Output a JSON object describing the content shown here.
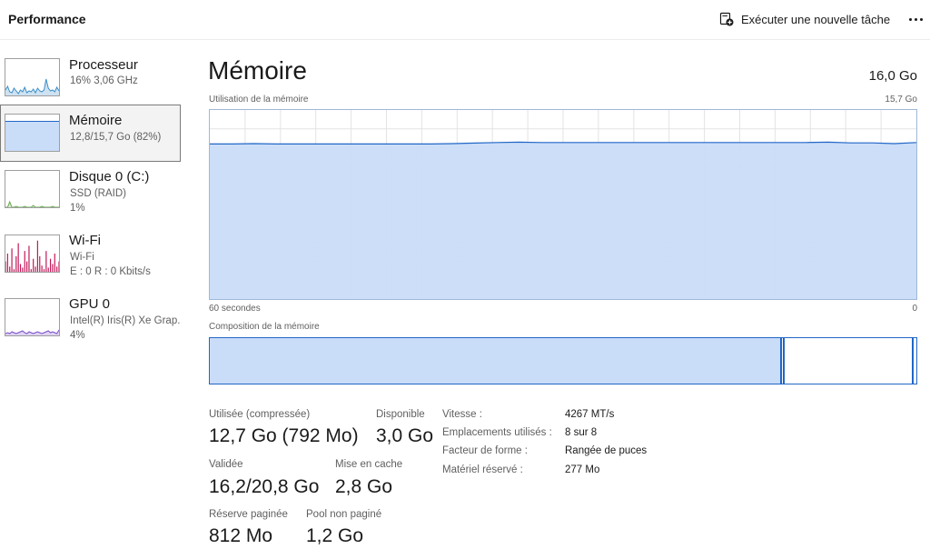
{
  "header": {
    "title": "Performance",
    "run_task_label": "Exécuter une nouvelle tâche",
    "run_task_icon": "new-task-icon",
    "more_icon": "more-horizontal-icon"
  },
  "sidebar": {
    "items": [
      {
        "name": "Processeur",
        "sub1": "16%  3,06 GHz",
        "sub2": "",
        "color": "#3a8dc9",
        "series": [
          6,
          10,
          4,
          3,
          8,
          5,
          2,
          6,
          4,
          9,
          3,
          5,
          4,
          7,
          3,
          8,
          5,
          4,
          6,
          18,
          8,
          5,
          6,
          4,
          9,
          5
        ]
      },
      {
        "name": "Mémoire",
        "sub1": "12,8/15,7 Go (82%)",
        "sub2": "",
        "color": "#2167c7",
        "selected": true
      },
      {
        "name": "Disque 0 (C:)",
        "sub1": "SSD (RAID)",
        "sub2": "1%",
        "color": "#6aa84f",
        "series": [
          0,
          0,
          6,
          0,
          0,
          1,
          0,
          0,
          0,
          1,
          0,
          0,
          0,
          2,
          0,
          0,
          0,
          1,
          0,
          0,
          0,
          0,
          1,
          0,
          0,
          0
        ]
      },
      {
        "name": "Wi-Fi",
        "sub1": "Wi-Fi",
        "sub2": "E : 0 R : 0 Kbits/s",
        "color": "#c2185b",
        "series": [
          20,
          35,
          10,
          45,
          5,
          30,
          55,
          15,
          8,
          40,
          20,
          50,
          5,
          25,
          10,
          60,
          30,
          12,
          5,
          40,
          8,
          25,
          15,
          35,
          10,
          20
        ]
      },
      {
        "name": "GPU 0",
        "sub1": "Intel(R) Iris(R) Xe Grap...",
        "sub2": "4%",
        "color": "#7b4fc9",
        "series": [
          2,
          3,
          2,
          4,
          3,
          2,
          3,
          4,
          5,
          3,
          2,
          4,
          3,
          2,
          3,
          4,
          3,
          2,
          3,
          4,
          5,
          3,
          4,
          3,
          2,
          6
        ]
      }
    ]
  },
  "main": {
    "title": "Mémoire",
    "total": "16,0 Go",
    "graph_label": "Utilisation de la mémoire",
    "graph_max": "15,7 Go",
    "time_left": "60 secondes",
    "time_right": "0",
    "composition_label": "Composition de la mémoire",
    "composition": {
      "in_use_fraction": 0.81,
      "modified_fraction": 0.005,
      "standby_fraction": 0.18
    },
    "graph_series": [
      82,
      82,
      82.2,
      82,
      82,
      82,
      82,
      82,
      82,
      82,
      82,
      82.2,
      82.5,
      82.8,
      83,
      82.8,
      82.8,
      82.8,
      82.8,
      82.8,
      82.8,
      82.8,
      82.8,
      82.8,
      82.8,
      82.8,
      82.8,
      82.8,
      83,
      82.6,
      82.6,
      82.2,
      82.8
    ],
    "graph_fill": "#c9dcf8",
    "graph_line": "#2167c7",
    "stats": {
      "used_label": "Utilisée (compressée)",
      "used_value": "12,7 Go (792 Mo)",
      "available_label": "Disponible",
      "available_value": "3,0 Go",
      "committed_label": "Validée",
      "committed_value": "16,2/20,8 Go",
      "cached_label": "Mise en cache",
      "cached_value": "2,8 Go",
      "paged_label": "Réserve paginée",
      "paged_value": "812 Mo",
      "nonpaged_label": "Pool non paginé",
      "nonpaged_value": "1,2 Go"
    },
    "properties": [
      {
        "label": "Vitesse :",
        "value": "4267 MT/s"
      },
      {
        "label": "Emplacements utilisés :",
        "value": "8 sur 8"
      },
      {
        "label": "Facteur de forme :",
        "value": "Rangée de puces"
      },
      {
        "label": "Matériel réservé :",
        "value": "277 Mo"
      }
    ]
  }
}
